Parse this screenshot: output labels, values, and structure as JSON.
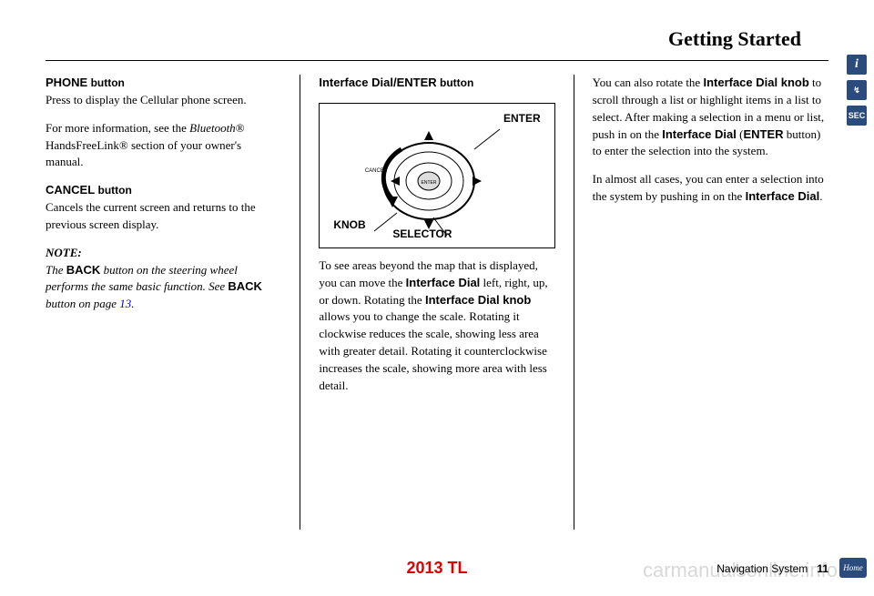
{
  "header": {
    "title": "Getting Started"
  },
  "col1": {
    "phone_heading": "PHONE",
    "phone_heading_suffix": " button",
    "phone_body": "Press to display the Cellular phone screen.",
    "phone_more": "For more information, see the ",
    "phone_more_italic": "Bluetooth",
    "phone_more_reg": "® HandsFreeLink® section of your owner's manual.",
    "cancel_heading": "CANCEL",
    "cancel_heading_suffix": " button",
    "cancel_body": "Cancels the current screen and returns to the previous screen display.",
    "note_label": "NOTE:",
    "note_body_1": "The ",
    "note_back": "BACK",
    "note_body_2": " button on the steering wheel performs the same basic function. See ",
    "note_back2": "BACK",
    "note_body_3": " button",
    "note_body_4": " on page ",
    "note_link": "13",
    "note_body_5": "."
  },
  "col2": {
    "heading": "Interface Dial/ENTER",
    "heading_suffix": " button",
    "fig_enter": "ENTER",
    "fig_knob": "KNOB",
    "fig_selector": "SELECTOR",
    "body_1": "To see areas beyond the map that is displayed, you can move the ",
    "bold_1": "Interface Dial",
    "body_2": " left, right, up, or down. Rotating the ",
    "bold_2": "Interface Dial knob",
    "body_3": " allows you to change the scale. Rotating it clockwise reduces the scale, showing less area with greater detail. Rotating it counterclockwise increases the scale, showing more area with less detail."
  },
  "col3": {
    "body_1": "You can also rotate the ",
    "bold_1": "Interface Dial knob",
    "body_2": " to scroll through a list or highlight items in a list to select. After making a selection in a menu or list, push in on the ",
    "bold_2": "Interface Dial",
    "body_3": " (",
    "bold_3": "ENTER",
    "body_4": " button) to enter the selection into the system.",
    "body_5": "In almost all cases, you can enter a selection into the system by pushing in on the ",
    "bold_4": "Interface Dial",
    "body_6": "."
  },
  "footer": {
    "model": "2013 TL",
    "nav_label": "Navigation System",
    "page": "11"
  },
  "side": {
    "info": "i",
    "nav": "↯",
    "sec": "SEC",
    "home": "Home"
  },
  "watermark": "carmanualsonline.info"
}
